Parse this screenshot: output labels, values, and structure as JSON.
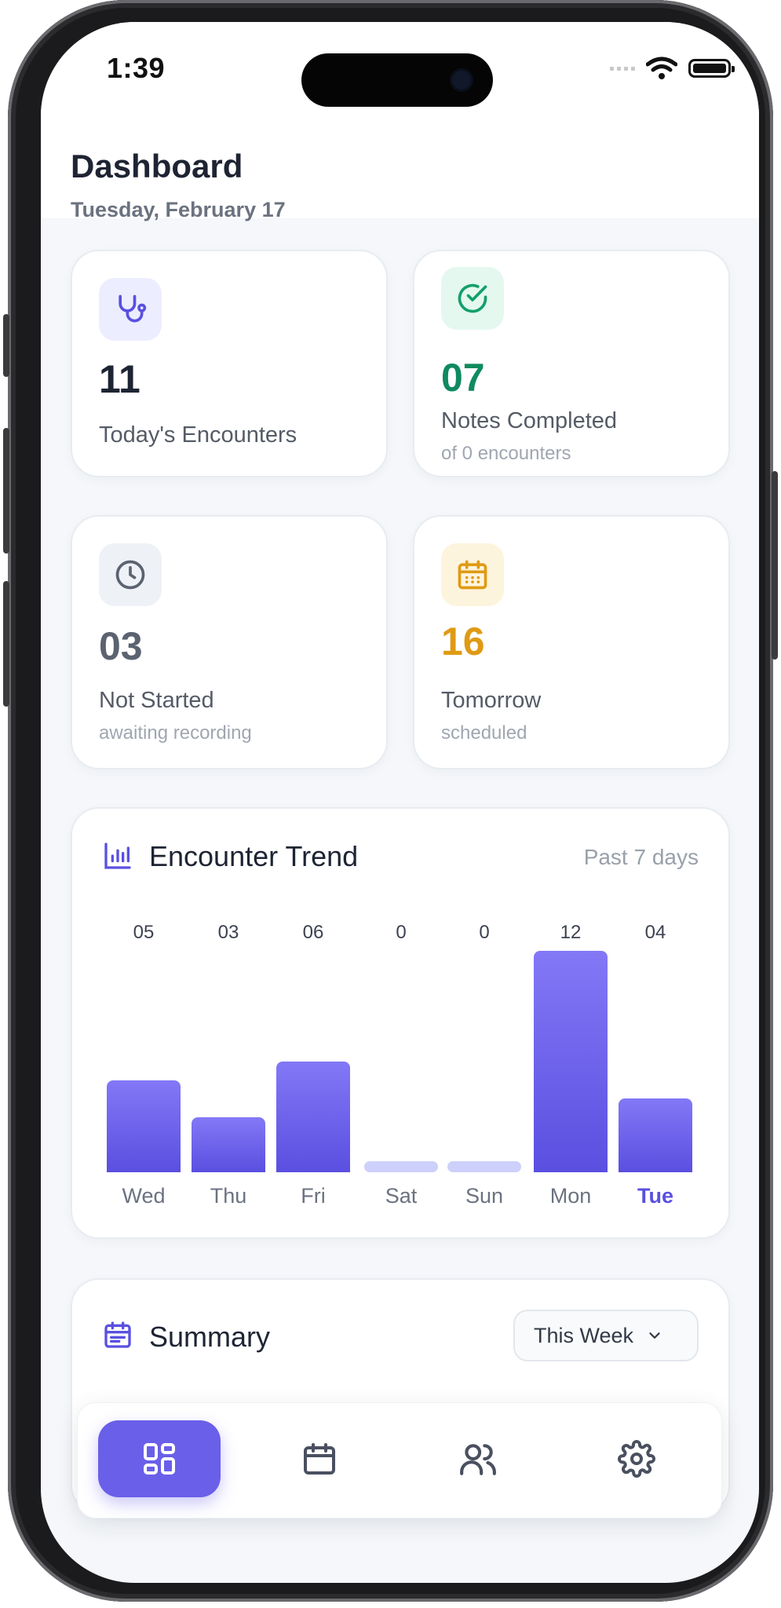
{
  "status_bar": {
    "time": "1:39"
  },
  "header": {
    "title": "Dashboard",
    "date": "Tuesday, February 17"
  },
  "stats": {
    "encounters": {
      "value": "11",
      "label": "Today's Encounters",
      "icon": "stethoscope-icon",
      "color": "#1e2433"
    },
    "notes": {
      "value": "07",
      "label": "Notes Completed",
      "sub": "of 0 encounters",
      "icon": "check-circle-icon",
      "color": "#0f8a5f"
    },
    "not_started": {
      "value": "03",
      "label": "Not Started",
      "sub": "awaiting recording",
      "icon": "clock-icon",
      "color": "#5b6270"
    },
    "tomorrow": {
      "value": "16",
      "label": "Tomorrow",
      "sub": "scheduled",
      "icon": "calendar-icon",
      "color": "#e09a14"
    }
  },
  "trend": {
    "title": "Encounter Trend",
    "period": "Past 7 days",
    "icon": "bar-chart-icon"
  },
  "chart_data": {
    "type": "bar",
    "categories": [
      "Wed",
      "Thu",
      "Fri",
      "Sat",
      "Sun",
      "Mon",
      "Tue"
    ],
    "values": [
      5,
      3,
      6,
      0,
      0,
      12,
      4
    ],
    "value_labels": [
      "05",
      "03",
      "06",
      "0",
      "0",
      "12",
      "04"
    ],
    "highlighted_category": "Tue",
    "colors": {
      "bar": "#6a5fe8",
      "zero_bar": "#cdd0fb",
      "highlight_label": "#5a50e0"
    }
  },
  "summary": {
    "title": "Summary",
    "range": "This Week",
    "icon": "calendar-list-icon"
  },
  "tabbar": {
    "tabs": [
      {
        "name": "dashboard",
        "icon": "grid-icon",
        "active": true
      },
      {
        "name": "calendar",
        "icon": "calendar-icon",
        "active": false
      },
      {
        "name": "patients",
        "icon": "users-icon",
        "active": false
      },
      {
        "name": "settings",
        "icon": "gear-icon",
        "active": false
      }
    ]
  },
  "colors": {
    "accent": "#6a5fe8",
    "background": "#f5f7fa",
    "card": "#ffffff"
  }
}
